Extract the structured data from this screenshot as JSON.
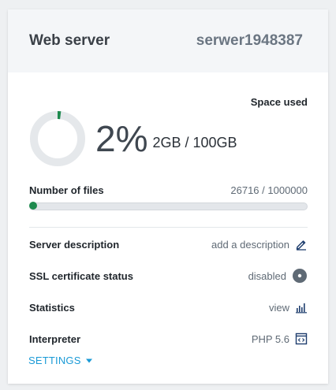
{
  "header": {
    "title": "Web server",
    "server_name": "serwer1948387"
  },
  "space": {
    "label": "Space used",
    "percent": "2%",
    "percent_value": 0.02,
    "usage": "2GB / 100GB"
  },
  "files": {
    "label": "Number of files",
    "count": "26716 / 1000000",
    "fraction": 0.0267
  },
  "rows": {
    "description": {
      "label": "Server description",
      "value": "add a description",
      "icon": "pencil-icon"
    },
    "ssl": {
      "label": "SSL certificate status",
      "value": "disabled",
      "icon": "disabled-dot-icon"
    },
    "statistics": {
      "label": "Statistics",
      "value": "view",
      "icon": "bar-chart-icon"
    },
    "interpreter": {
      "label": "Interpreter",
      "value": "PHP 5.6",
      "icon": "code-window-icon"
    }
  },
  "settings": {
    "label": "SETTINGS",
    "icon": "caret-down-icon"
  },
  "colors": {
    "accent": "#1a9ad6",
    "progress": "#1e8a4e",
    "donut_track": "#e5e8eb",
    "ssl_dot": "#5f6a75"
  }
}
